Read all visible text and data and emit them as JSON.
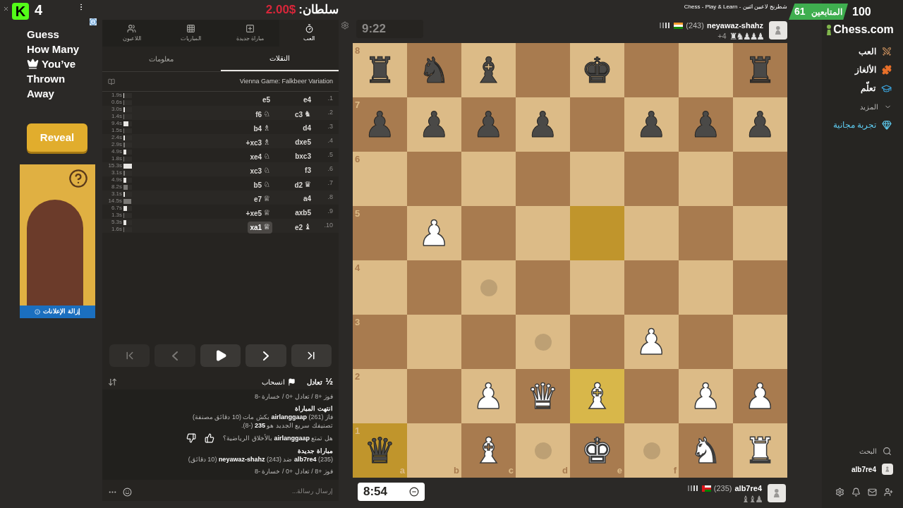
{
  "stream_overlay": {
    "logo": "K",
    "count": "4"
  },
  "ad": {
    "lines": [
      "Guess",
      "How Many",
      "You’ve",
      "Thrown",
      "Away"
    ],
    "button": "Reveal",
    "remove_ads": "إزالة الإعلانات"
  },
  "donation": {
    "label": "سلطان:",
    "amount": "2.00$"
  },
  "panel": {
    "tabs": [
      {
        "label": "العب",
        "kind": "play",
        "selected": true
      },
      {
        "label": "مباراة جديدة",
        "kind": "new",
        "selected": false
      },
      {
        "label": "المباريات",
        "kind": "games",
        "selected": false
      },
      {
        "label": "اللاعبون",
        "kind": "players",
        "selected": false
      }
    ],
    "subtabs": [
      {
        "label": "النقلات",
        "selected": true
      },
      {
        "label": "معلومات",
        "selected": false
      }
    ],
    "opening": "Vienna Game: Falkbeer Variation",
    "moves": [
      {
        "number": "1.",
        "white": {
          "san": "e4",
          "selected": false
        },
        "black": {
          "san": "e5",
          "selected": false
        },
        "times": [
          {
            "text": "1.9s",
            "level": 0.12
          },
          {
            "text": "0.6s",
            "level": 0.04
          }
        ]
      },
      {
        "number": "2.",
        "white": {
          "san": "c3",
          "figurine": "♞",
          "selected": false
        },
        "black": {
          "san": "f6",
          "figurine": "♘",
          "selected": false
        },
        "times": [
          {
            "text": "3.0s",
            "level": 0.2
          },
          {
            "text": "1.4s",
            "level": 0.09
          }
        ]
      },
      {
        "number": "3.",
        "white": {
          "san": "d4",
          "selected": false
        },
        "black": {
          "san": "b4",
          "figurine": "♗",
          "selected": false
        },
        "times": [
          {
            "text": "9.4s",
            "level": 0.61
          },
          {
            "text": "1.5s",
            "level": 0.1
          }
        ]
      },
      {
        "number": "4.",
        "white": {
          "san": "dxe5",
          "selected": false
        },
        "black": {
          "san": "xc3+",
          "figurine": "♗",
          "selected": false
        },
        "times": [
          {
            "text": "2.4s",
            "level": 0.16
          },
          {
            "text": "2.9s",
            "level": 0.19
          }
        ]
      },
      {
        "number": "5.",
        "white": {
          "san": "bxc3",
          "selected": false
        },
        "black": {
          "san": "xe4",
          "figurine": "♘",
          "selected": false
        },
        "times": [
          {
            "text": "4.9s",
            "level": 0.32
          },
          {
            "text": "1.8s",
            "level": 0.12
          }
        ]
      },
      {
        "number": "6.",
        "white": {
          "san": "f3",
          "selected": false
        },
        "black": {
          "san": "xc3",
          "figurine": "♘",
          "selected": false
        },
        "times": [
          {
            "text": "15.3s",
            "level": 1
          },
          {
            "text": "3.1s",
            "level": 0.2
          }
        ]
      },
      {
        "number": "7.",
        "white": {
          "san": "d2",
          "figurine": "♛",
          "selected": false
        },
        "black": {
          "san": "b5",
          "figurine": "♘",
          "selected": false
        },
        "times": [
          {
            "text": "4.9s",
            "level": 0.32
          },
          {
            "text": "8.2s",
            "level": 0.54
          }
        ]
      },
      {
        "number": "8.",
        "white": {
          "san": "a4",
          "selected": false
        },
        "black": {
          "san": "e7",
          "figurine": "♕",
          "selected": false
        },
        "times": [
          {
            "text": "3.1s",
            "level": 0.2
          },
          {
            "text": "14.5s",
            "level": 0.95
          }
        ]
      },
      {
        "number": "9.",
        "white": {
          "san": "axb5",
          "selected": false
        },
        "black": {
          "san": "xe5+",
          "figurine": "♕",
          "selected": false
        },
        "times": [
          {
            "text": "6.7s",
            "level": 0.44
          },
          {
            "text": "1.3s",
            "level": 0.08
          }
        ]
      },
      {
        "number": "10.",
        "white": {
          "san": "e2",
          "figurine": "♝",
          "selected": false
        },
        "black": {
          "san": "xa1",
          "figurine": "♕",
          "selected": true
        },
        "times": [
          {
            "text": "5.3s",
            "level": 0.35
          },
          {
            "text": "1.6s",
            "level": 0.1
          }
        ]
      }
    ],
    "actions": {
      "draw_symbol": "½",
      "draw": "تعادل",
      "resign": "انسحاب"
    },
    "chat": {
      "messages": [
        {
          "kind": "text",
          "text": "فوز +8 / تعادل +0 / خسارة -8"
        },
        {
          "kind": "event",
          "title": "انتهت المباراة",
          "lines": [
            "فاز (261) **airlanggaap** بكش مات (10 دقائق مصنفة)",
            "تصنيفك سريع الجديد هو **235** (-8)."
          ]
        },
        {
          "kind": "vote",
          "text": "هل تمتع **airlanggaap** بالأخلاق الرياضية؟"
        },
        {
          "kind": "event",
          "title": "مباراة جديدة",
          "lines": [
            "(235) **alb7re4** ضد (243) **neyawaz-shahz** (10 دقائق)"
          ]
        },
        {
          "kind": "text",
          "text": "فوز +8 / تعادل +0 / خسارة -8"
        }
      ],
      "placeholder": "إرسال رسالة..."
    }
  },
  "window_title": "Chess - Play & Learn - شطرنج لاعبين اثنين",
  "top_player": {
    "name": "neyawaz-shahz",
    "rating": "(243)",
    "flag": {
      "kind": "india"
    },
    "captured": "♜♞♟♟♟",
    "advantage": "+4",
    "clock": "9:22",
    "clock_active": false
  },
  "board": {
    "ranks": [
      {
        "label": "8",
        "cells": [
          {
            "piece": "♜",
            "kind": "black",
            "highlighted": false,
            "hint": false
          },
          {
            "highlighted": false,
            "hint": false
          },
          {
            "highlighted": false,
            "hint": false
          },
          {
            "piece": "♚",
            "kind": "black",
            "highlighted": false,
            "hint": false
          },
          {
            "highlighted": false,
            "hint": false
          },
          {
            "piece": "♝",
            "kind": "black",
            "highlighted": false,
            "hint": false
          },
          {
            "piece": "♞",
            "kind": "black",
            "highlighted": false,
            "hint": false
          },
          {
            "piece": "♜",
            "kind": "black",
            "highlighted": false,
            "hint": false
          }
        ]
      },
      {
        "label": "7",
        "cells": [
          {
            "piece": "♟",
            "kind": "black",
            "highlighted": false,
            "hint": false
          },
          {
            "piece": "♟",
            "kind": "black",
            "highlighted": false,
            "hint": false
          },
          {
            "piece": "♟",
            "kind": "black",
            "highlighted": false,
            "hint": false
          },
          {
            "highlighted": false,
            "hint": false
          },
          {
            "piece": "♟",
            "kind": "black",
            "highlighted": false,
            "hint": false
          },
          {
            "piece": "♟",
            "kind": "black",
            "highlighted": false,
            "hint": false
          },
          {
            "piece": "♟",
            "kind": "black",
            "highlighted": false,
            "hint": false
          },
          {
            "piece": "♟",
            "kind": "black",
            "highlighted": false,
            "hint": false
          }
        ]
      },
      {
        "label": "6",
        "cells": [
          {
            "highlighted": false,
            "hint": false
          },
          {
            "highlighted": false,
            "hint": false
          },
          {
            "highlighted": false,
            "hint": false
          },
          {
            "highlighted": false,
            "hint": false
          },
          {
            "highlighted": false,
            "hint": false
          },
          {
            "highlighted": false,
            "hint": false
          },
          {
            "highlighted": false,
            "hint": false
          },
          {
            "highlighted": false,
            "hint": false
          }
        ]
      },
      {
        "label": "5",
        "cells": [
          {
            "highlighted": false,
            "hint": false
          },
          {
            "highlighted": false,
            "hint": false
          },
          {
            "highlighted": false,
            "hint": false
          },
          {
            "highlighted": true,
            "hint": false
          },
          {
            "highlighted": false,
            "hint": false
          },
          {
            "highlighted": false,
            "hint": false
          },
          {
            "piece": "♟",
            "kind": "white",
            "highlighted": false,
            "hint": false
          },
          {
            "highlighted": false,
            "hint": false
          }
        ]
      },
      {
        "label": "4",
        "cells": [
          {
            "highlighted": false,
            "hint": false
          },
          {
            "highlighted": false,
            "hint": false
          },
          {
            "highlighted": false,
            "hint": false
          },
          {
            "highlighted": false,
            "hint": false
          },
          {
            "highlighted": false,
            "hint": false
          },
          {
            "highlighted": false,
            "hint": true
          },
          {
            "highlighted": false,
            "hint": false
          },
          {
            "highlighted": false,
            "hint": false
          }
        ]
      },
      {
        "label": "3",
        "cells": [
          {
            "highlighted": false,
            "hint": false
          },
          {
            "highlighted": false,
            "hint": false
          },
          {
            "piece": "♟",
            "kind": "white",
            "highlighted": false,
            "hint": false
          },
          {
            "highlighted": false,
            "hint": false
          },
          {
            "highlighted": false,
            "hint": true
          },
          {
            "highlighted": false,
            "hint": false
          },
          {
            "highlighted": false,
            "hint": false
          },
          {
            "highlighted": false,
            "hint": false
          }
        ]
      },
      {
        "label": "2",
        "cells": [
          {
            "piece": "♟",
            "kind": "white",
            "highlighted": false,
            "hint": false
          },
          {
            "piece": "♟",
            "kind": "white",
            "highlighted": false,
            "hint": false
          },
          {
            "highlighted": false,
            "hint": false
          },
          {
            "piece": "♝",
            "kind": "white",
            "highlighted": true,
            "hint": false
          },
          {
            "piece": "♛",
            "kind": "white",
            "highlighted": false,
            "hint": false
          },
          {
            "piece": "♟",
            "kind": "white",
            "highlighted": false,
            "hint": false
          },
          {
            "highlighted": false,
            "hint": false
          },
          {
            "highlighted": false,
            "hint": false
          }
        ]
      },
      {
        "label": "1",
        "cells": [
          {
            "piece": "♜",
            "kind": "white",
            "highlighted": false,
            "hint": false
          },
          {
            "piece": "♞",
            "kind": "white",
            "highlighted": false,
            "hint": false
          },
          {
            "highlighted": false,
            "hint": true
          },
          {
            "piece": "♚",
            "kind": "white",
            "highlighted": false,
            "hint": false
          },
          {
            "highlighted": false,
            "hint": true
          },
          {
            "piece": "♝",
            "kind": "white",
            "highlighted": false,
            "hint": false
          },
          {
            "highlighted": false,
            "hint": false
          },
          {
            "piece": "♛",
            "kind": "black",
            "highlighted": true,
            "hint": false
          }
        ]
      }
    ],
    "files": [
      "f",
      "e",
      "d",
      "c",
      "b",
      "a"
    ]
  },
  "bottom_player": {
    "name": "alb7re4",
    "rating": "(235)",
    "flag": {
      "kind": "oman"
    },
    "captured": "♝♝♟",
    "clock": "8:54",
    "clock_active": true
  },
  "followers": {
    "total": "100",
    "label": "المتابعين",
    "count": "61"
  },
  "sidebar": {
    "logo": "Chess.com",
    "nav": [
      {
        "label": "العب",
        "kind": "play"
      },
      {
        "label": "الألغاز",
        "kind": "puzzles"
      },
      {
        "label": "تعلّم",
        "kind": "learn"
      },
      {
        "label": "المزيد",
        "kind": "more"
      },
      {
        "label": "تجربة مجانية",
        "kind": "trial"
      }
    ],
    "search": "البحث",
    "user": "alb7re4"
  }
}
